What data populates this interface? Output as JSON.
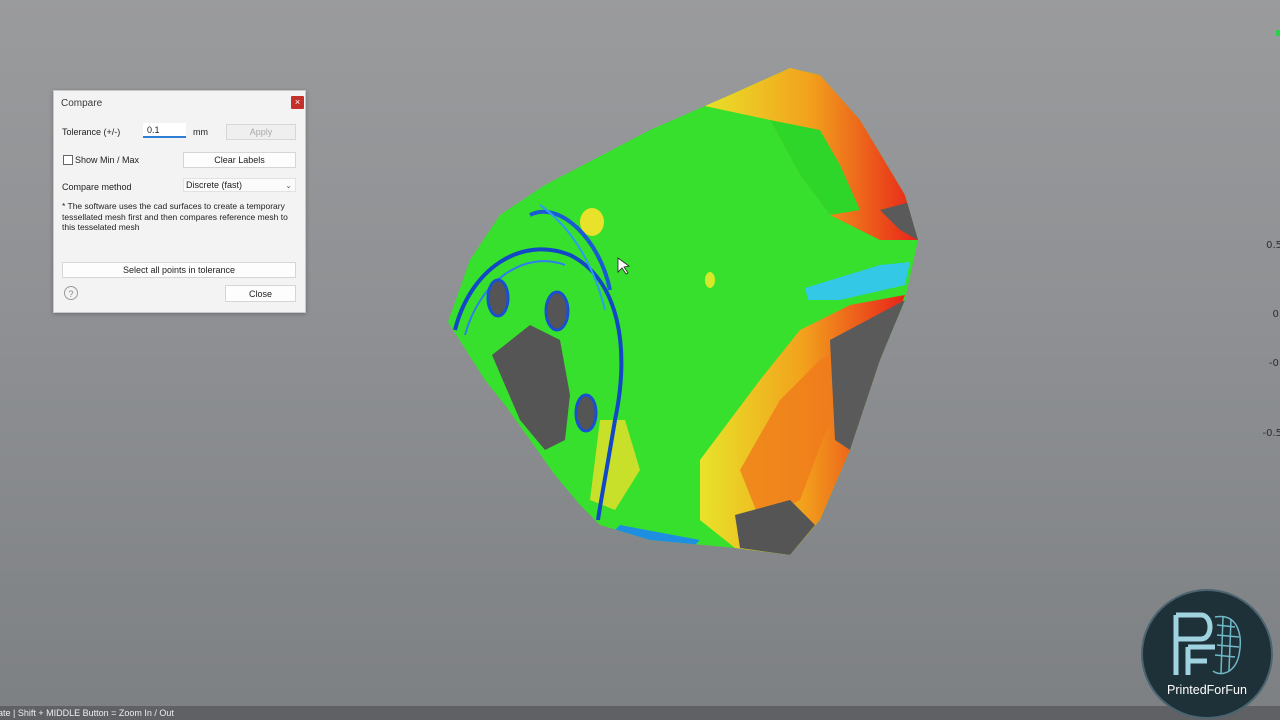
{
  "dialog": {
    "title": "Compare",
    "close_icon": "close-icon",
    "tolerance_label": "Tolerance (+/-)",
    "tolerance_value": "0.1",
    "tolerance_unit": "mm",
    "apply_label": "Apply",
    "show_minmax_label": "Show Min / Max",
    "show_minmax_checked": false,
    "clear_labels_label": "Clear Labels",
    "compare_method_label": "Compare method",
    "compare_method_value": "Discrete (fast)",
    "note": "* The software uses the cad surfaces to create a temporary tessellated mesh first and then compares reference mesh to this tesselated mesh",
    "select_points_label": "Select all points in tolerance",
    "close_label": "Close",
    "help_icon": "help-icon"
  },
  "scale": {
    "labels": [
      "0.5",
      "0.",
      "-0.",
      "-0.5"
    ]
  },
  "statusbar": {
    "text": "ate | Shift + MIDDLE Button = Zoom In / Out"
  },
  "logo": {
    "text": "PrintedForFun"
  },
  "colors": {
    "in_tolerance": "#33e02b",
    "above": "#e8231a",
    "below": "#1f6fe0"
  }
}
